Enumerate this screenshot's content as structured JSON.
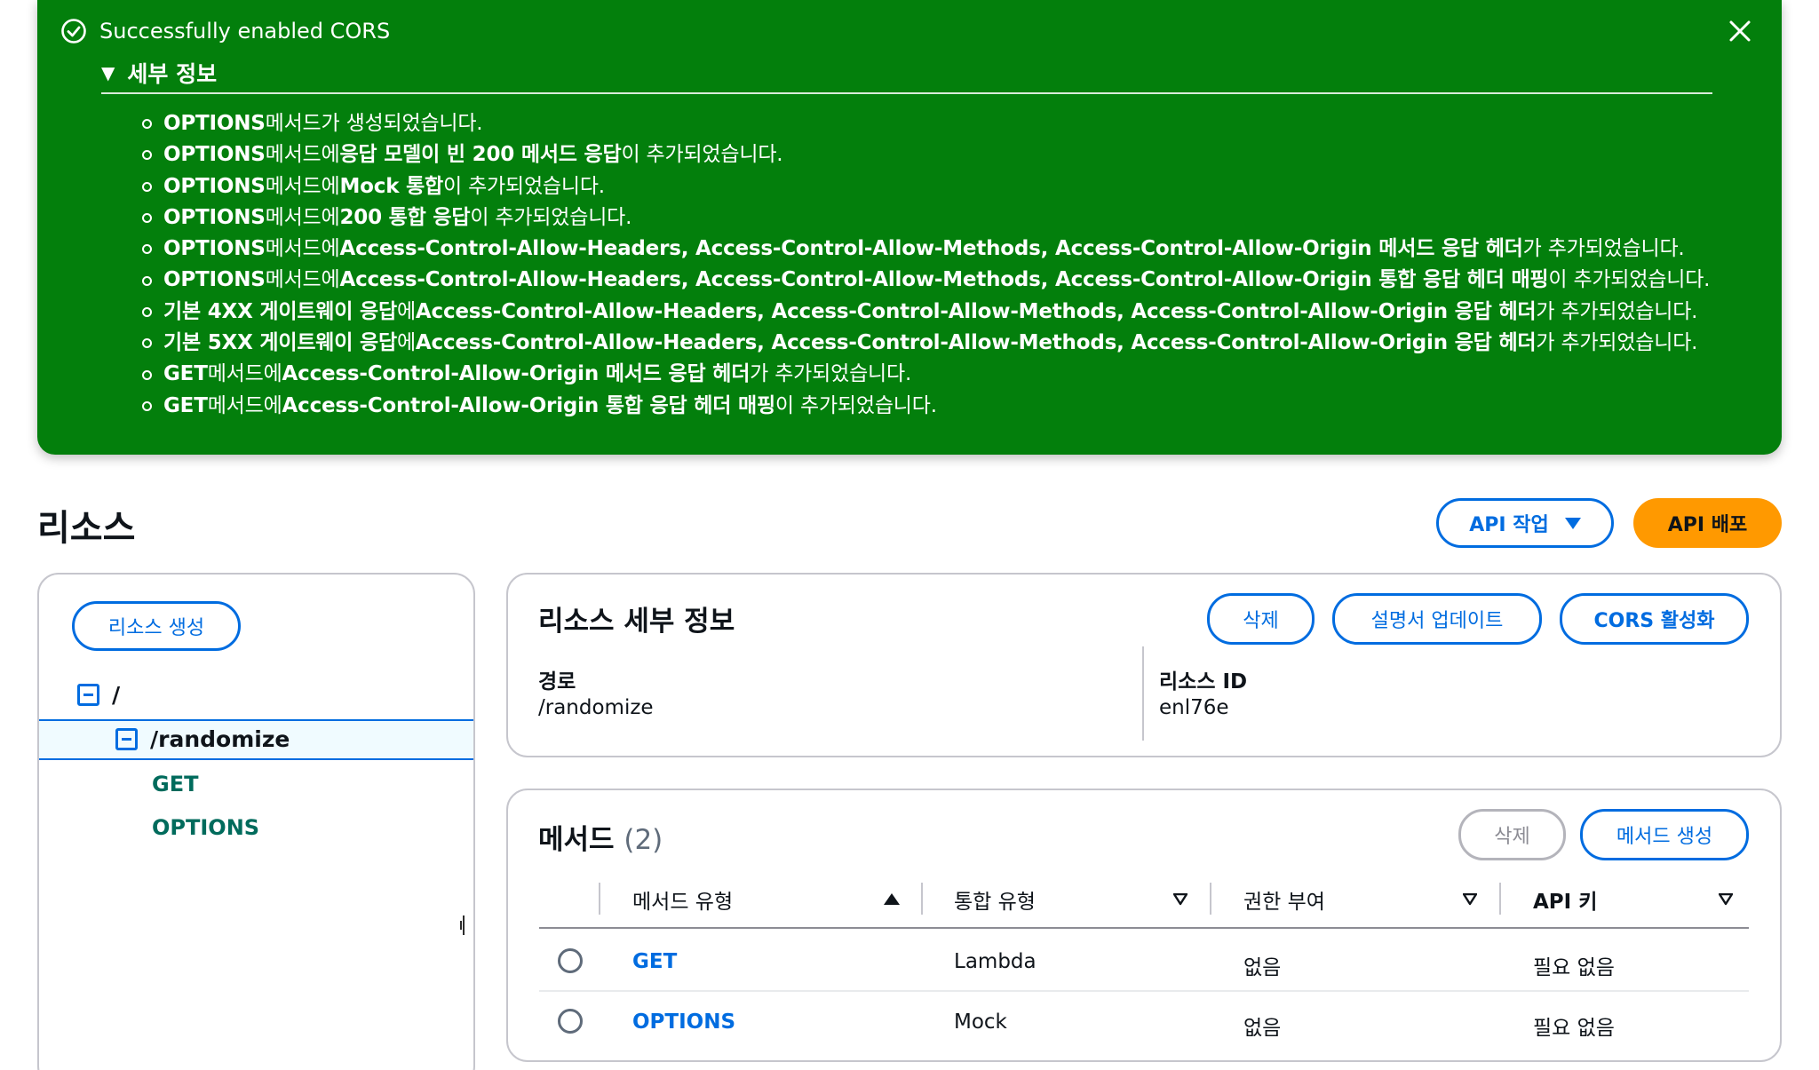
{
  "flash": {
    "title": "Successfully enabled CORS",
    "details_label": "세부 정보",
    "items": [
      [
        {
          "t": "OPTIONS",
          "b": true
        },
        {
          "t": " 메서드가 생성되었습니다.",
          "b": false
        }
      ],
      [
        {
          "t": "OPTIONS",
          "b": true
        },
        {
          "t": " 메서드에 ",
          "b": false
        },
        {
          "t": "응답 모델이 빈 200 메서드 응답",
          "b": true
        },
        {
          "t": "이 추가되었습니다.",
          "b": false
        }
      ],
      [
        {
          "t": "OPTIONS",
          "b": true
        },
        {
          "t": " 메서드에 ",
          "b": false
        },
        {
          "t": "Mock 통합",
          "b": true
        },
        {
          "t": "이 추가되었습니다.",
          "b": false
        }
      ],
      [
        {
          "t": "OPTIONS",
          "b": true
        },
        {
          "t": " 메서드에 ",
          "b": false
        },
        {
          "t": "200 통합 응답",
          "b": true
        },
        {
          "t": "이 추가되었습니다.",
          "b": false
        }
      ],
      [
        {
          "t": "OPTIONS",
          "b": true
        },
        {
          "t": " 메서드에 ",
          "b": false
        },
        {
          "t": "Access-Control-Allow-Headers, Access-Control-Allow-Methods, Access-Control-Allow-Origin 메서드 응답 헤더",
          "b": true
        },
        {
          "t": "가 추가되었습니다.",
          "b": false
        }
      ],
      [
        {
          "t": "OPTIONS",
          "b": true
        },
        {
          "t": " 메서드에 ",
          "b": false
        },
        {
          "t": "Access-Control-Allow-Headers, Access-Control-Allow-Methods, Access-Control-Allow-Origin 통합 응답 헤더 매핑",
          "b": true
        },
        {
          "t": "이 추가되었습니다.",
          "b": false
        }
      ],
      [
        {
          "t": "기본 4XX 게이트웨이 응답",
          "b": true
        },
        {
          "t": "에 ",
          "b": false
        },
        {
          "t": "Access-Control-Allow-Headers, Access-Control-Allow-Methods, Access-Control-Allow-Origin 응답 헤더",
          "b": true
        },
        {
          "t": "가 추가되었습니다.",
          "b": false
        }
      ],
      [
        {
          "t": "기본 5XX 게이트웨이 응답",
          "b": true
        },
        {
          "t": "에 ",
          "b": false
        },
        {
          "t": "Access-Control-Allow-Headers, Access-Control-Allow-Methods, Access-Control-Allow-Origin 응답 헤더",
          "b": true
        },
        {
          "t": "가 추가되었습니다.",
          "b": false
        }
      ],
      [
        {
          "t": "GET",
          "b": true
        },
        {
          "t": " 메서드에 ",
          "b": false
        },
        {
          "t": "Access-Control-Allow-Origin 메서드 응답 헤더",
          "b": true
        },
        {
          "t": "가 추가되었습니다.",
          "b": false
        }
      ],
      [
        {
          "t": "GET",
          "b": true
        },
        {
          "t": " 메서드에 ",
          "b": false
        },
        {
          "t": "Access-Control-Allow-Origin 통합 응답 헤더 매핑",
          "b": true
        },
        {
          "t": "이 추가되었습니다.",
          "b": false
        }
      ]
    ]
  },
  "page": {
    "title": "리소스",
    "api_actions_label": "API 작업",
    "deploy_label": "API 배포"
  },
  "tree": {
    "create_resource_label": "리소스 생성",
    "root": "/",
    "resource": "/randomize",
    "methods": [
      "GET",
      "OPTIONS"
    ]
  },
  "details": {
    "heading": "리소스 세부 정보",
    "delete_label": "삭제",
    "update_docs_label": "설명서 업데이트",
    "enable_cors_label": "CORS 활성화",
    "path_label": "경로",
    "path_value": "/randomize",
    "id_label": "리소스 ID",
    "id_value": "enl76e"
  },
  "methods_panel": {
    "heading": "메서드",
    "count": "(2)",
    "delete_label": "삭제",
    "create_label": "메서드 생성",
    "columns": [
      "메서드 유형",
      "통합 유형",
      "권한 부여",
      "API 키"
    ],
    "rows": [
      {
        "method": "GET",
        "integration": "Lambda",
        "auth": "없음",
        "api_key": "필요 없음"
      },
      {
        "method": "OPTIONS",
        "integration": "Mock",
        "auth": "없음",
        "api_key": "필요 없음"
      }
    ]
  },
  "colors": {
    "success_green": "#037f0c",
    "primary_orange": "#ff9900",
    "link_blue": "#006ce0",
    "tree_method_teal": "#006b5c"
  }
}
